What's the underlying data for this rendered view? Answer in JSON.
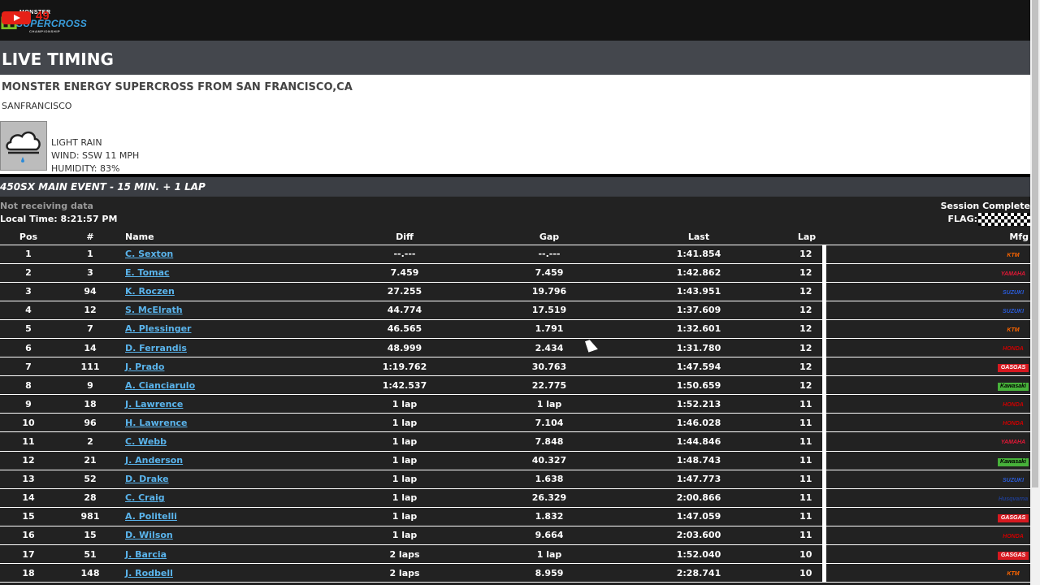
{
  "topbar": {
    "youtube_count": "49",
    "logo": {
      "brand": "MONSTER",
      "title": "SUPERCROSS",
      "sub": "CHAMPIONSHIP"
    }
  },
  "header": {
    "title": "LIVE TIMING"
  },
  "event": {
    "name": "MONSTER ENERGY SUPERCROSS FROM SAN FRANCISCO,CA",
    "city": "SANFRANCISCO",
    "weather": {
      "icon": "rain-cloud-icon",
      "condition": "LIGHT RAIN",
      "wind": "WIND: SSW 11 MPH",
      "humidity": "HUMIDITY: 83%"
    }
  },
  "session": {
    "title": "450SX MAIN EVENT - 15 MIN. + 1 LAP",
    "data_status": "Not receiving data",
    "local_time": "Local Time: 8:21:57 PM",
    "status": "Session Complete",
    "flag_label": "FLAG:",
    "flag_icon": "checkered-flag-icon"
  },
  "table": {
    "headers": {
      "pos": "Pos",
      "num": "#",
      "name": "Name",
      "diff": "Diff",
      "gap": "Gap",
      "last": "Last",
      "lap": "Lap",
      "mfg": "Mfg"
    },
    "rows": [
      {
        "pos": "1",
        "num": "1",
        "name": "C. Sexton",
        "diff": "--.---",
        "gap": "--.---",
        "last": "1:41.854",
        "lap": "12",
        "mfg": "KTM"
      },
      {
        "pos": "2",
        "num": "3",
        "name": "E. Tomac",
        "diff": "7.459",
        "gap": "7.459",
        "last": "1:42.862",
        "lap": "12",
        "mfg": "YAMAHA"
      },
      {
        "pos": "3",
        "num": "94",
        "name": "K. Roczen",
        "diff": "27.255",
        "gap": "19.796",
        "last": "1:43.951",
        "lap": "12",
        "mfg": "SUZUKI"
      },
      {
        "pos": "4",
        "num": "12",
        "name": "S. McElrath",
        "diff": "44.774",
        "gap": "17.519",
        "last": "1:37.609",
        "lap": "12",
        "mfg": "SUZUKI"
      },
      {
        "pos": "5",
        "num": "7",
        "name": "A. Plessinger",
        "diff": "46.565",
        "gap": "1.791",
        "last": "1:32.601",
        "lap": "12",
        "mfg": "KTM"
      },
      {
        "pos": "6",
        "num": "14",
        "name": "D. Ferrandis",
        "diff": "48.999",
        "gap": "2.434",
        "last": "1:31.780",
        "lap": "12",
        "mfg": "HONDA"
      },
      {
        "pos": "7",
        "num": "111",
        "name": "J. Prado",
        "diff": "1:19.762",
        "gap": "30.763",
        "last": "1:47.594",
        "lap": "12",
        "mfg": "GASGAS"
      },
      {
        "pos": "8",
        "num": "9",
        "name": "A. Cianciarulo",
        "diff": "1:42.537",
        "gap": "22.775",
        "last": "1:50.659",
        "lap": "12",
        "mfg": "Kawasaki"
      },
      {
        "pos": "9",
        "num": "18",
        "name": "J. Lawrence",
        "diff": "1 lap",
        "gap": "1 lap",
        "last": "1:52.213",
        "lap": "11",
        "mfg": "HONDA"
      },
      {
        "pos": "10",
        "num": "96",
        "name": "H. Lawrence",
        "diff": "1 lap",
        "gap": "7.104",
        "last": "1:46.028",
        "lap": "11",
        "mfg": "HONDA"
      },
      {
        "pos": "11",
        "num": "2",
        "name": "C. Webb",
        "diff": "1 lap",
        "gap": "7.848",
        "last": "1:44.846",
        "lap": "11",
        "mfg": "YAMAHA"
      },
      {
        "pos": "12",
        "num": "21",
        "name": "J. Anderson",
        "diff": "1 lap",
        "gap": "40.327",
        "last": "1:48.743",
        "lap": "11",
        "mfg": "Kawasaki"
      },
      {
        "pos": "13",
        "num": "52",
        "name": "D. Drake",
        "diff": "1 lap",
        "gap": "1.638",
        "last": "1:47.773",
        "lap": "11",
        "mfg": "SUZUKI"
      },
      {
        "pos": "14",
        "num": "28",
        "name": "C. Craig",
        "diff": "1 lap",
        "gap": "26.329",
        "last": "2:00.866",
        "lap": "11",
        "mfg": "Husqvarna"
      },
      {
        "pos": "15",
        "num": "981",
        "name": "A. Politelli",
        "diff": "1 lap",
        "gap": "1.832",
        "last": "1:47.059",
        "lap": "11",
        "mfg": "GASGAS"
      },
      {
        "pos": "16",
        "num": "15",
        "name": "D. Wilson",
        "diff": "1 lap",
        "gap": "9.664",
        "last": "2:03.600",
        "lap": "11",
        "mfg": "HONDA"
      },
      {
        "pos": "17",
        "num": "51",
        "name": "J. Barcia",
        "diff": "2 laps",
        "gap": "1 lap",
        "last": "1:52.040",
        "lap": "10",
        "mfg": "GASGAS"
      },
      {
        "pos": "18",
        "num": "148",
        "name": "J. Rodbell",
        "diff": "2 laps",
        "gap": "8.959",
        "last": "2:28.741",
        "lap": "10",
        "mfg": "KTM"
      }
    ]
  },
  "mfg_styles": {
    "KTM": {
      "bg": "#222222",
      "fg": "#ff6600"
    },
    "YAMAHA": {
      "bg": "#222222",
      "fg": "#e21836"
    },
    "SUZUKI": {
      "bg": "#222222",
      "fg": "#2a5bd7"
    },
    "HONDA": {
      "bg": "#222222",
      "fg": "#cc0000"
    },
    "GASGAS": {
      "bg": "#d71920",
      "fg": "#ffffff"
    },
    "Kawasaki": {
      "bg": "#47b13a",
      "fg": "#000000"
    },
    "Husqvarna": {
      "bg": "#222222",
      "fg": "#1f3c8c"
    }
  }
}
